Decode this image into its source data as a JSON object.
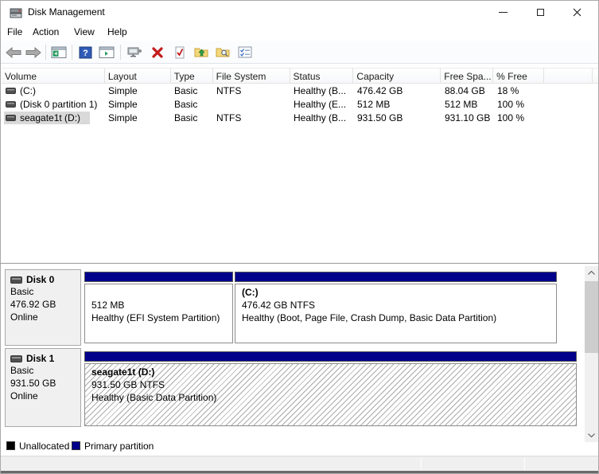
{
  "window": {
    "title": "Disk Management",
    "control_icons": [
      "minimize-icon",
      "maximize-icon",
      "close-icon"
    ]
  },
  "menu": {
    "items": [
      "File",
      "Action",
      "View",
      "Help"
    ]
  },
  "toolbar": {
    "icon_names": [
      "back-arrow-icon",
      "forward-arrow-icon",
      "console-tree-icon",
      "help-icon",
      "action-pane-icon",
      "remote-computer-icon",
      "delete-icon",
      "check-document-icon",
      "folder-up-icon",
      "folder-search-icon",
      "properties-icon"
    ]
  },
  "volume_list": {
    "columns": [
      "Volume",
      "Layout",
      "Type",
      "File System",
      "Status",
      "Capacity",
      "Free Spa...",
      "% Free",
      ""
    ],
    "rows": [
      {
        "volume": "(C:)",
        "layout": "Simple",
        "type": "Basic",
        "file_system": "NTFS",
        "status": "Healthy (B...",
        "capacity": "476.42 GB",
        "free_space": "88.04 GB",
        "percent_free": "18 %",
        "selected": false
      },
      {
        "volume": "(Disk 0 partition 1)",
        "layout": "Simple",
        "type": "Basic",
        "file_system": "",
        "status": "Healthy (E...",
        "capacity": "512 MB",
        "free_space": "512 MB",
        "percent_free": "100 %",
        "selected": false
      },
      {
        "volume": "seagate1t (D:)",
        "layout": "Simple",
        "type": "Basic",
        "file_system": "NTFS",
        "status": "Healthy (B...",
        "capacity": "931.50 GB",
        "free_space": "931.10 GB",
        "percent_free": "100 %",
        "selected": true
      }
    ]
  },
  "disks": [
    {
      "name": "Disk 0",
      "type": "Basic",
      "size": "476.92 GB",
      "status": "Online",
      "partitions": [
        {
          "name": "",
          "size_line": "512 MB",
          "status_line": "Healthy (EFI System Partition)"
        },
        {
          "name": "(C:)",
          "size_line": "476.42 GB NTFS",
          "status_line": "Healthy (Boot, Page File, Crash Dump, Basic Data Partition)"
        }
      ]
    },
    {
      "name": "Disk 1",
      "type": "Basic",
      "size": "931.50 GB",
      "status": "Online",
      "partitions": [
        {
          "name": "seagate1t  (D:)",
          "size_line": "931.50 GB NTFS",
          "status_line": "Healthy (Basic Data Partition)"
        }
      ]
    }
  ],
  "legend": {
    "items": [
      {
        "label": "Unallocated",
        "color": "#000000"
      },
      {
        "label": "Primary partition",
        "color": "#00008B"
      }
    ]
  },
  "colors": {
    "primary_partition": "#00008B",
    "unallocated": "#000000",
    "selection_inactive": "#d9d9d9"
  }
}
